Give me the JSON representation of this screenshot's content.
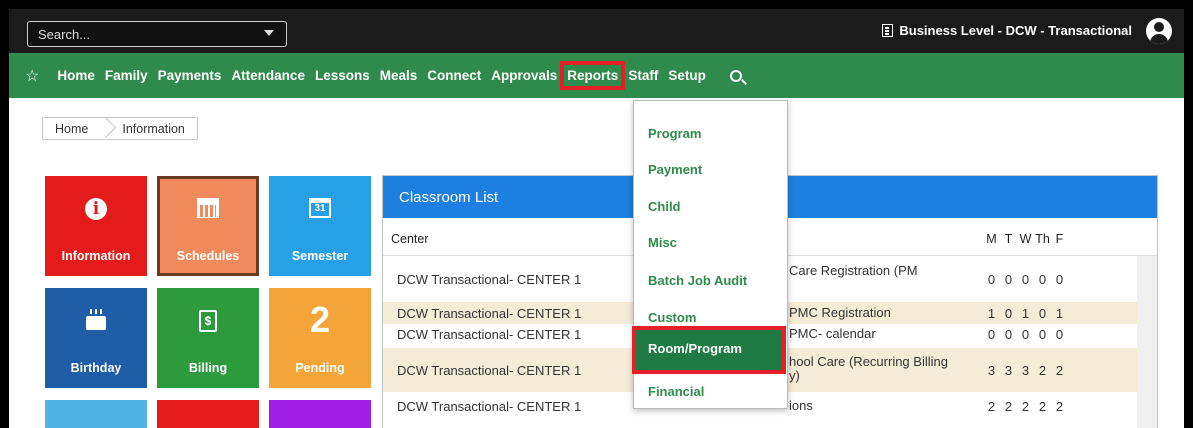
{
  "topbar": {
    "search_placeholder": "Search...",
    "business_level": "Business Level - DCW - Transactional"
  },
  "nav": {
    "items": [
      "Home",
      "Family",
      "Payments",
      "Attendance",
      "Lessons",
      "Meals",
      "Connect",
      "Approvals",
      "Reports",
      "Staff",
      "Setup"
    ],
    "active": "Reports"
  },
  "breadcrumb": {
    "home": "Home",
    "current": "Information"
  },
  "tiles": [
    {
      "label": "Information",
      "color": "#e31b1b",
      "icon": "info-icon"
    },
    {
      "label": "Schedules",
      "color": "#f08a5c",
      "icon": "schedule-icon"
    },
    {
      "label": "Semester",
      "color": "#27a0e6",
      "icon": "calendar-icon",
      "icon_text": "31"
    },
    {
      "label": "Birthday",
      "color": "#1f5ea6",
      "icon": "cake-icon"
    },
    {
      "label": "Billing",
      "color": "#2e9a3e",
      "icon": "bill-icon",
      "icon_text": "$"
    },
    {
      "label": "Pending",
      "color": "#f3a53a",
      "icon": "count",
      "icon_text": "2"
    }
  ],
  "classroom": {
    "title": "Classroom List",
    "col_center": "Center",
    "days": [
      "M",
      "T",
      "W",
      "Th",
      "F"
    ],
    "rows": [
      {
        "center": "DCW Transactional- CENTER 1",
        "program": "Care Registration (PM",
        "values": [
          "0",
          "0",
          "0",
          "0",
          "0"
        ]
      },
      {
        "center": "DCW Transactional- CENTER 1",
        "program": "PMC Registration",
        "values": [
          "1",
          "0",
          "1",
          "0",
          "1"
        ]
      },
      {
        "center": "DCW Transactional- CENTER 1",
        "program": "PMC- calendar",
        "values": [
          "0",
          "0",
          "0",
          "0",
          "0"
        ]
      },
      {
        "center": "DCW Transactional- CENTER 1",
        "program": "hool Care (Recurring Billing",
        "program2": "y)",
        "values": [
          "3",
          "3",
          "3",
          "2",
          "2"
        ]
      },
      {
        "center": "DCW Transactional- CENTER 1",
        "program": "ions",
        "values": [
          "2",
          "2",
          "2",
          "2",
          "2"
        ]
      }
    ]
  },
  "reports_menu": {
    "items": [
      "Program",
      "Payment",
      "Child",
      "Misc",
      "Batch Job Audit",
      "Custom",
      "Room/Program",
      "Financial"
    ],
    "selected": "Room/Program"
  },
  "colors": {
    "nav_green": "#2e8b4b",
    "panel_blue": "#1d7fe0",
    "highlight_red": "#e3202a"
  }
}
